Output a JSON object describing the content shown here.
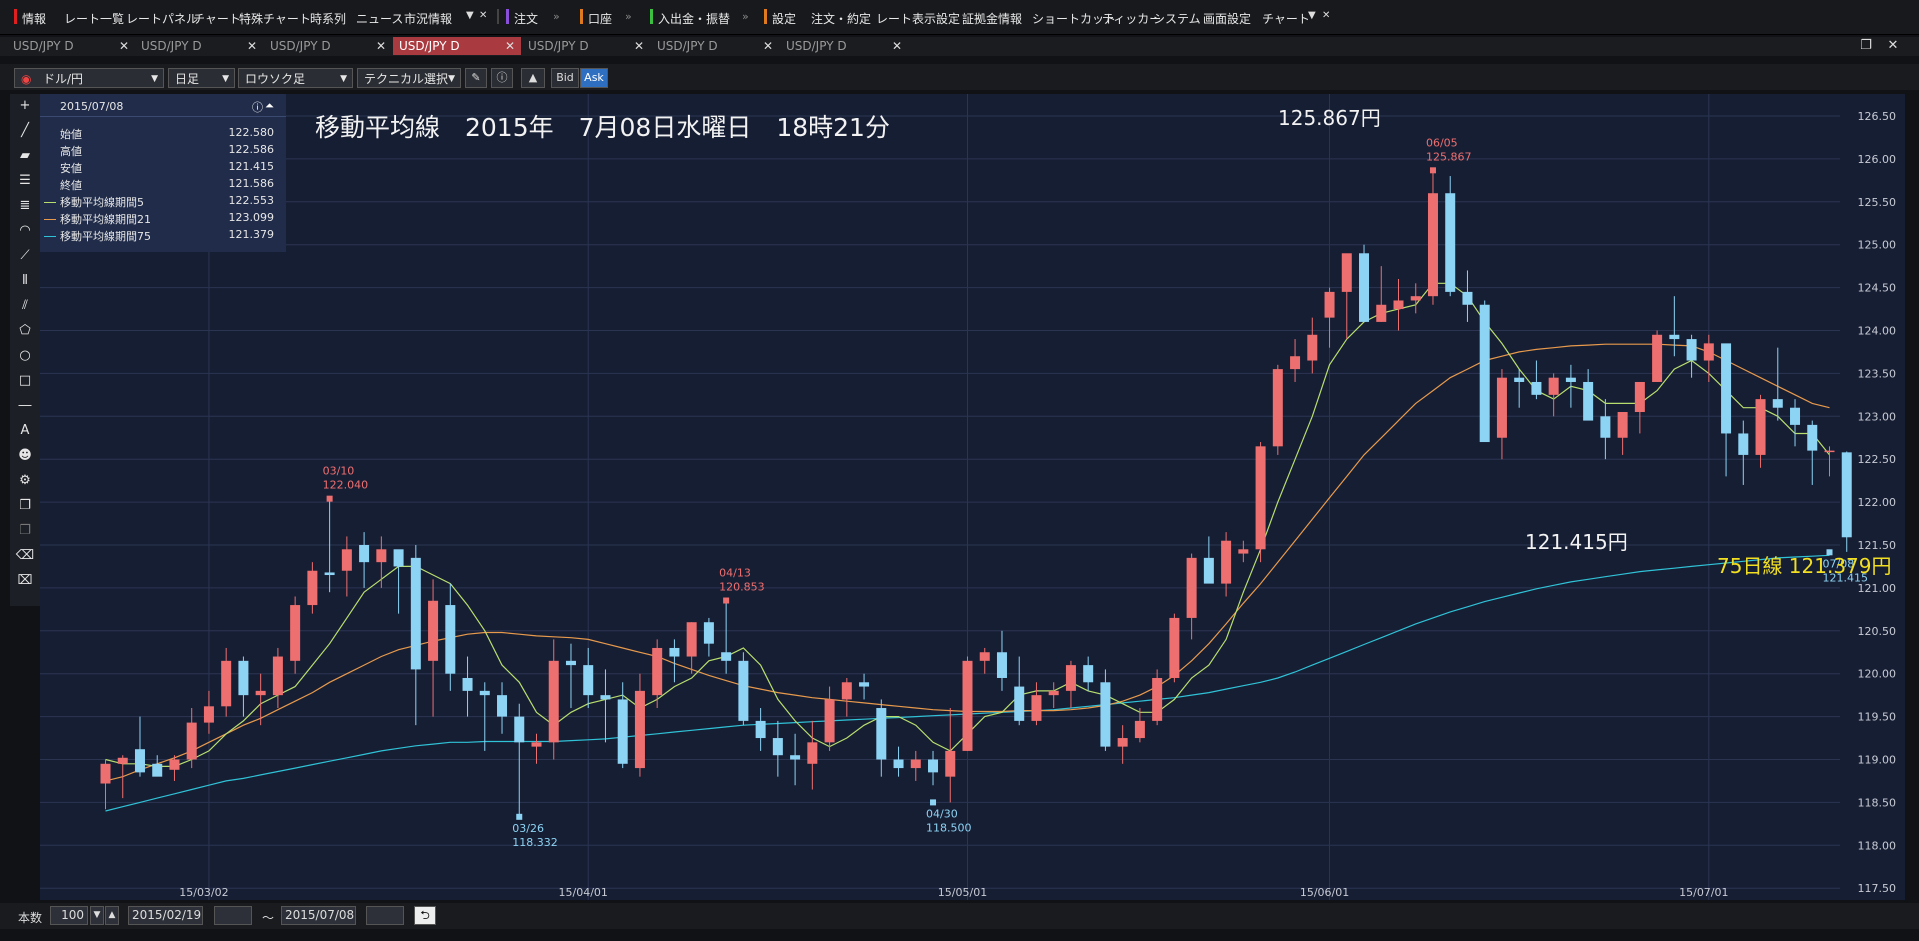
{
  "menubar": {
    "info": "情報",
    "items": [
      "レート一覧",
      "レートパネル",
      "チャート",
      "特殊チャート",
      "時系列",
      "ニュース",
      "市況情報"
    ],
    "order": "注文",
    "account": "口座",
    "deposit": "入出金・振替",
    "settings": "設定",
    "items2": [
      "注文・約定",
      "レート表示設定",
      "証拠金情報",
      "ショートカット",
      "ティッカー",
      "システム",
      "画面設定",
      "チャート"
    ]
  },
  "tabs": [
    "USD/JPY D",
    "USD/JPY D",
    "USD/JPY D",
    "USD/JPY D",
    "USD/JPY D",
    "USD/JPY D",
    "USD/JPY D"
  ],
  "active_tab": 3,
  "toolbar": {
    "pair": "ドル/円",
    "timeframe": "日足",
    "chart_type": "ロウソク足",
    "technical": "テクニカル選択",
    "bid": "Bid",
    "ask": "Ask"
  },
  "chart_title": "移動平均線　2015年　7月08日水曜日　18時21分",
  "info_panel": {
    "date": "2015/07/08",
    "rows": [
      {
        "label": "始値",
        "value": "122.580"
      },
      {
        "label": "高値",
        "value": "122.586"
      },
      {
        "label": "安値",
        "value": "121.415"
      },
      {
        "label": "終値",
        "value": "121.586"
      },
      {
        "label": "移動平均線期間5",
        "value": "122.553"
      },
      {
        "label": "移動平均線期間21",
        "value": "123.099"
      },
      {
        "label": "移動平均線期間75",
        "value": "121.379"
      }
    ]
  },
  "annotations": {
    "high_big": "125.867円",
    "low_big": "121.415円",
    "ma75_big": "75日線 121.379円"
  },
  "colors": {
    "up": "#ee6f6f",
    "down": "#8dd3f3",
    "ma5": "#b8de6e",
    "ma21": "#e89a4c",
    "ma75": "#30c2d6",
    "background": "#161e34",
    "accent_tab": "#a93a3f"
  },
  "bottom": {
    "count_label": "本数",
    "count": "100",
    "start": "2015/02/19",
    "tilde": "〜",
    "end": "2015/07/08"
  },
  "chart_data": {
    "type": "candlestick",
    "y_unit": "JPY",
    "ylim": [
      117.5,
      126.5
    ],
    "y_ticks": [
      "117.50",
      "118.00",
      "118.50",
      "119.00",
      "119.50",
      "120.00",
      "120.50",
      "121.00",
      "121.50",
      "122.00",
      "122.50",
      "123.00",
      "123.50",
      "124.00",
      "124.50",
      "125.00",
      "125.50",
      "126.00",
      "126.50"
    ],
    "x_ticks": [
      {
        "label": "15/03/02",
        "index": 6
      },
      {
        "label": "15/04/01",
        "index": 28
      },
      {
        "label": "15/05/01",
        "index": 50
      },
      {
        "label": "15/06/01",
        "index": 71
      },
      {
        "label": "15/07/01",
        "index": 93
      }
    ],
    "candles": [
      [
        118.72,
        119.0,
        118.42,
        118.95
      ],
      [
        118.95,
        119.05,
        118.55,
        119.02
      ],
      [
        119.12,
        119.5,
        118.8,
        118.85
      ],
      [
        118.95,
        119.05,
        118.85,
        118.8
      ],
      [
        118.88,
        119.05,
        118.75,
        119.0
      ],
      [
        119.0,
        119.6,
        118.9,
        119.43
      ],
      [
        119.43,
        119.8,
        119.3,
        119.62
      ],
      [
        119.62,
        120.3,
        119.5,
        120.15
      ],
      [
        120.15,
        120.2,
        119.5,
        119.75
      ],
      [
        119.75,
        120.0,
        119.4,
        119.8
      ],
      [
        119.75,
        120.3,
        119.6,
        120.2
      ],
      [
        120.15,
        120.9,
        120.0,
        120.8
      ],
      [
        120.8,
        121.3,
        120.7,
        121.2
      ],
      [
        121.18,
        122.07,
        120.95,
        121.15
      ],
      [
        121.2,
        121.6,
        120.9,
        121.45
      ],
      [
        121.5,
        121.65,
        121.0,
        121.3
      ],
      [
        121.3,
        121.6,
        121.0,
        121.45
      ],
      [
        121.45,
        121.4,
        120.7,
        121.25
      ],
      [
        121.35,
        121.5,
        119.4,
        120.05
      ],
      [
        120.15,
        121.1,
        119.5,
        120.85
      ],
      [
        120.8,
        121.05,
        119.8,
        120.0
      ],
      [
        119.95,
        120.2,
        119.5,
        119.8
      ],
      [
        119.8,
        119.9,
        119.1,
        119.75
      ],
      [
        119.75,
        119.9,
        119.3,
        119.5
      ],
      [
        119.5,
        119.65,
        118.35,
        119.2
      ],
      [
        119.15,
        119.3,
        118.95,
        119.2
      ],
      [
        119.2,
        120.4,
        119.0,
        120.15
      ],
      [
        120.15,
        120.35,
        119.6,
        120.1
      ],
      [
        120.1,
        120.3,
        119.6,
        119.75
      ],
      [
        119.75,
        120.05,
        119.2,
        119.7
      ],
      [
        119.7,
        119.9,
        118.9,
        118.95
      ],
      [
        118.9,
        120.0,
        118.8,
        119.8
      ],
      [
        119.75,
        120.4,
        119.6,
        120.3
      ],
      [
        120.3,
        120.4,
        119.9,
        120.2
      ],
      [
        120.2,
        120.6,
        120.0,
        120.6
      ],
      [
        120.6,
        120.65,
        120.2,
        120.35
      ],
      [
        120.25,
        120.87,
        120.0,
        120.15
      ],
      [
        120.15,
        120.25,
        119.4,
        119.45
      ],
      [
        119.45,
        119.6,
        119.1,
        119.25
      ],
      [
        119.25,
        119.45,
        118.8,
        119.05
      ],
      [
        119.05,
        119.3,
        118.7,
        119.0
      ],
      [
        118.95,
        119.45,
        118.65,
        119.2
      ],
      [
        119.2,
        119.85,
        119.1,
        119.7
      ],
      [
        119.7,
        119.95,
        119.5,
        119.9
      ],
      [
        119.9,
        120.0,
        119.7,
        119.85
      ],
      [
        119.6,
        119.7,
        118.8,
        119.0
      ],
      [
        119.0,
        119.15,
        118.8,
        118.9
      ],
      [
        118.9,
        119.1,
        118.75,
        119.0
      ],
      [
        119.0,
        119.1,
        118.7,
        118.85
      ],
      [
        118.8,
        119.6,
        118.5,
        119.1
      ],
      [
        119.1,
        120.2,
        119.1,
        120.15
      ],
      [
        120.15,
        120.3,
        120.0,
        120.25
      ],
      [
        120.25,
        120.5,
        119.8,
        119.95
      ],
      [
        119.85,
        120.2,
        119.4,
        119.45
      ],
      [
        119.45,
        119.9,
        119.4,
        119.75
      ],
      [
        119.75,
        119.9,
        119.6,
        119.8
      ],
      [
        119.8,
        120.15,
        119.6,
        120.1
      ],
      [
        120.1,
        120.2,
        119.8,
        119.9
      ],
      [
        119.9,
        120.05,
        119.1,
        119.15
      ],
      [
        119.15,
        119.4,
        118.95,
        119.25
      ],
      [
        119.25,
        119.6,
        119.2,
        119.45
      ],
      [
        119.45,
        120.05,
        119.4,
        119.95
      ],
      [
        119.95,
        120.7,
        119.9,
        120.65
      ],
      [
        120.65,
        121.4,
        120.4,
        121.35
      ],
      [
        121.35,
        121.6,
        121.1,
        121.05
      ],
      [
        121.05,
        121.65,
        120.9,
        121.55
      ],
      [
        121.4,
        121.55,
        121.3,
        121.45
      ],
      [
        121.45,
        122.7,
        121.3,
        122.65
      ],
      [
        122.65,
        123.6,
        122.55,
        123.55
      ],
      [
        123.55,
        123.9,
        123.4,
        123.7
      ],
      [
        123.65,
        124.15,
        123.5,
        123.95
      ],
      [
        124.15,
        124.5,
        123.8,
        124.45
      ],
      [
        124.45,
        124.85,
        123.9,
        124.9
      ],
      [
        124.9,
        125.0,
        124.2,
        124.1
      ],
      [
        124.1,
        124.75,
        124.1,
        124.3
      ],
      [
        124.25,
        124.6,
        124.0,
        124.35
      ],
      [
        124.35,
        124.55,
        124.2,
        124.4
      ],
      [
        124.4,
        125.87,
        124.3,
        125.6
      ],
      [
        125.6,
        125.8,
        124.4,
        124.45
      ],
      [
        124.45,
        124.7,
        124.1,
        124.3
      ],
      [
        124.3,
        124.35,
        122.7,
        122.7
      ],
      [
        122.75,
        123.55,
        122.5,
        123.45
      ],
      [
        123.45,
        123.55,
        123.1,
        123.4
      ],
      [
        123.4,
        123.65,
        123.2,
        123.25
      ],
      [
        123.25,
        123.5,
        123.0,
        123.45
      ],
      [
        123.45,
        123.6,
        123.1,
        123.4
      ],
      [
        123.4,
        123.55,
        123.3,
        122.95
      ],
      [
        123.0,
        123.2,
        122.5,
        122.75
      ],
      [
        122.75,
        122.9,
        122.55,
        123.05
      ],
      [
        123.05,
        123.4,
        122.8,
        123.4
      ],
      [
        123.4,
        124.0,
        123.4,
        123.95
      ],
      [
        123.95,
        124.4,
        123.7,
        123.9
      ],
      [
        123.9,
        123.95,
        123.45,
        123.65
      ],
      [
        123.65,
        123.95,
        123.4,
        123.85
      ],
      [
        123.85,
        123.8,
        122.3,
        122.8
      ],
      [
        122.8,
        122.95,
        122.2,
        122.55
      ],
      [
        122.55,
        123.25,
        122.4,
        123.2
      ],
      [
        123.2,
        123.8,
        122.95,
        123.1
      ],
      [
        123.1,
        123.2,
        122.65,
        122.9
      ],
      [
        122.9,
        122.95,
        122.2,
        122.6
      ],
      [
        122.6,
        122.65,
        122.3,
        122.6
      ],
      [
        122.58,
        122.59,
        121.42,
        121.59
      ]
    ],
    "ma5": [
      119.0,
      118.95,
      118.95,
      118.92,
      118.92,
      119.0,
      119.1,
      119.3,
      119.45,
      119.65,
      119.75,
      119.85,
      120.1,
      120.35,
      120.65,
      120.95,
      121.1,
      121.25,
      121.25,
      121.15,
      121.05,
      120.8,
      120.5,
      120.1,
      119.9,
      119.55,
      119.4,
      119.55,
      119.65,
      119.7,
      119.75,
      119.6,
      119.7,
      119.85,
      119.95,
      120.15,
      120.2,
      120.3,
      120.1,
      119.7,
      119.45,
      119.25,
      119.15,
      119.25,
      119.4,
      119.5,
      119.5,
      119.4,
      119.2,
      119.1,
      119.3,
      119.5,
      119.55,
      119.75,
      119.8,
      119.8,
      119.9,
      119.8,
      119.75,
      119.65,
      119.55,
      119.55,
      119.7,
      119.95,
      120.1,
      120.4,
      120.95,
      121.45,
      122.0,
      122.5,
      123.0,
      123.6,
      123.9,
      124.1,
      124.2,
      124.25,
      124.3,
      124.55,
      124.55,
      124.4,
      124.1,
      123.85,
      123.55,
      123.3,
      123.2,
      123.35,
      123.3,
      123.15,
      123.15,
      123.15,
      123.3,
      123.55,
      123.65,
      123.5,
      123.3,
      123.1,
      123.1,
      123.0,
      122.8,
      122.8,
      122.55
    ],
    "ma21": [
      118.75,
      118.8,
      118.88,
      118.95,
      119.02,
      119.1,
      119.2,
      119.3,
      119.4,
      119.48,
      119.58,
      119.68,
      119.78,
      119.9,
      120.0,
      120.1,
      120.2,
      120.28,
      120.33,
      120.38,
      120.42,
      120.46,
      120.48,
      120.48,
      120.46,
      120.44,
      120.43,
      120.42,
      120.4,
      120.35,
      120.3,
      120.25,
      120.2,
      120.12,
      120.05,
      119.98,
      119.92,
      119.86,
      119.82,
      119.78,
      119.75,
      119.72,
      119.7,
      119.68,
      119.66,
      119.64,
      119.62,
      119.6,
      119.58,
      119.57,
      119.56,
      119.56,
      119.56,
      119.57,
      119.57,
      119.57,
      119.58,
      119.6,
      119.63,
      119.68,
      119.75,
      119.85,
      119.98,
      120.15,
      120.35,
      120.58,
      120.82,
      121.05,
      121.3,
      121.55,
      121.8,
      122.05,
      122.3,
      122.55,
      122.75,
      122.95,
      123.15,
      123.3,
      123.45,
      123.55,
      123.65,
      123.7,
      123.75,
      123.78,
      123.8,
      123.82,
      123.83,
      123.84,
      123.84,
      123.84,
      123.84,
      123.83,
      123.82,
      123.75,
      123.65,
      123.55,
      123.45,
      123.35,
      123.25,
      123.15,
      123.1
    ],
    "ma75": [
      118.4,
      118.45,
      118.5,
      118.55,
      118.6,
      118.65,
      118.7,
      118.75,
      118.78,
      118.82,
      118.86,
      118.9,
      118.94,
      118.98,
      119.02,
      119.06,
      119.1,
      119.13,
      119.16,
      119.18,
      119.2,
      119.2,
      119.21,
      119.21,
      119.21,
      119.21,
      119.21,
      119.22,
      119.23,
      119.24,
      119.26,
      119.28,
      119.3,
      119.32,
      119.34,
      119.36,
      119.38,
      119.4,
      119.41,
      119.42,
      119.43,
      119.44,
      119.45,
      119.46,
      119.47,
      119.48,
      119.49,
      119.5,
      119.51,
      119.52,
      119.53,
      119.54,
      119.55,
      119.56,
      119.57,
      119.58,
      119.6,
      119.62,
      119.64,
      119.66,
      119.68,
      119.7,
      119.72,
      119.75,
      119.78,
      119.82,
      119.86,
      119.9,
      119.95,
      120.02,
      120.1,
      120.18,
      120.26,
      120.34,
      120.42,
      120.5,
      120.58,
      120.65,
      120.72,
      120.78,
      120.84,
      120.89,
      120.94,
      120.99,
      121.03,
      121.07,
      121.1,
      121.13,
      121.16,
      121.19,
      121.21,
      121.23,
      121.25,
      121.27,
      121.29,
      121.31,
      121.33,
      121.35,
      121.36,
      121.37,
      121.38
    ],
    "markers": [
      {
        "index": 13,
        "date": "03/10",
        "price": "122.040",
        "pos": "above",
        "color": "up"
      },
      {
        "index": 24,
        "date": "03/26",
        "price": "118.332",
        "pos": "below",
        "color": "down"
      },
      {
        "index": 36,
        "date": "04/13",
        "price": "120.853",
        "pos": "above",
        "color": "up"
      },
      {
        "index": 48,
        "date": "04/30",
        "price": "118.500",
        "pos": "below",
        "color": "down"
      },
      {
        "index": 77,
        "date": "06/05",
        "price": "125.867",
        "pos": "above",
        "color": "up"
      },
      {
        "index": 100,
        "date": "07/08",
        "price": "121.415",
        "pos": "below",
        "color": "down"
      }
    ]
  }
}
